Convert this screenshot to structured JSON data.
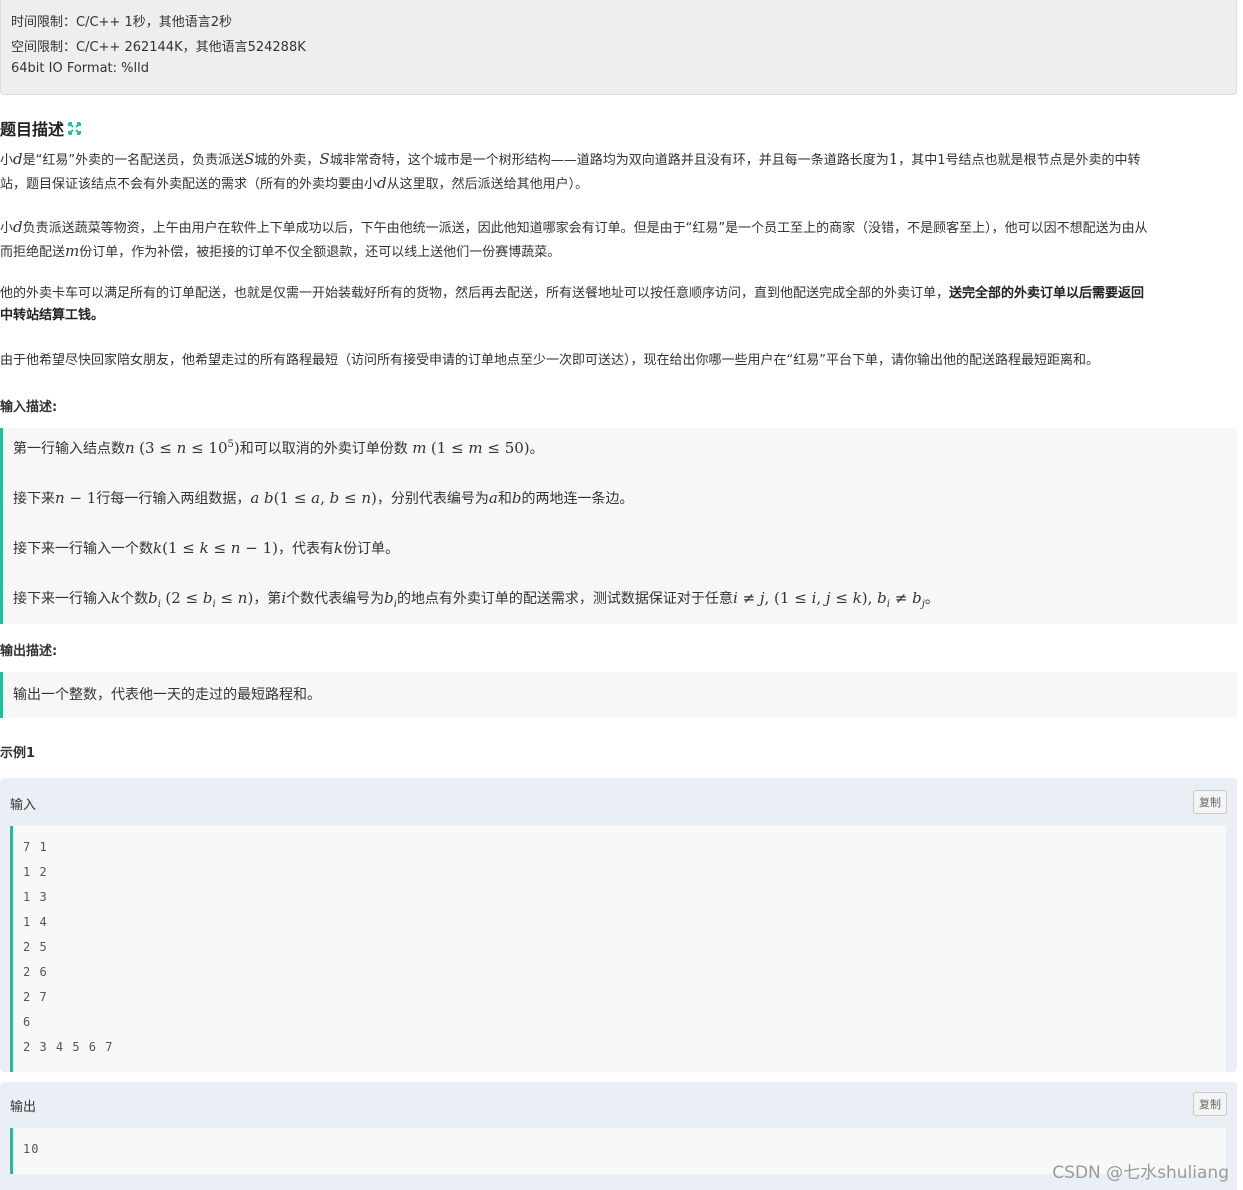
{
  "limits": {
    "time": "时间限制：C/C++ 1秒，其他语言2秒",
    "space": "空间限制：C/C++ 262144K，其他语言524288K",
    "io": "64bit IO Format: %lld"
  },
  "problem": {
    "title": "题目描述",
    "paragraphs": {
      "p1a": "小",
      "p1b": "是“红易”外卖的一名配送员，负责派送",
      "p1c": "城的外卖，",
      "p1d": "城非常奇特，这个城市是一个树形结构——道路均为双向道路并且没有环，并且每一条道路长度为",
      "p1e": "，其中1号结点也就是根节点是外卖的中转",
      "p1f": "站，题目保证该结点不会有外卖配送的需求（所有的外卖均要由小",
      "p1g": "从这里取，然后派送给其他用户）。",
      "p2a": "小",
      "p2b": "负责派送蔬菜等物资，上午由用户在软件上下单成功以后，下午由他统一派送，因此他知道哪家会有订单。但是由于“红易”是一个员工至上的商家（没错，不是顾客至上），他可以因不想配送为由从",
      "p2c": "而拒绝配送",
      "p2d": "份订单，作为补偿，被拒接的订单不仅全额退款，还可以线上送他们一份赛博蔬菜。",
      "p3a": "他的外卖卡车可以满足所有的订单配送，也就是仅需一开始装载好所有的货物，然后再去配送，所有送餐地址可以按任意顺序访问，直到他配送完成全部的外卖订单，",
      "p3b": "送完全部的外卖订单以后需要返回",
      "p3c": "中转站结算工钱。",
      "p4": "由于他希望尽快回家陪女朋友，他希望走过的所有路程最短（访问所有接受申请的订单地点至少一次即可送达），现在给出你哪一些用户在“红易”平台下单，请你输出他的配送路程最短距离和。"
    },
    "math": {
      "d": "d",
      "S": "S",
      "one": "1",
      "m": "m"
    }
  },
  "input": {
    "label": "输入描述:",
    "l1a": "第一行输入结点数",
    "l1b": "和可以取消的外卖订单份数 ",
    "l1c": "。",
    "l2a": "接下来",
    "l2b": "行每一行输入两组数据，",
    "l2c": "，分别代表编号为",
    "l2d": "和",
    "l2e": "的两地连一条边。",
    "l3a": "接下来一行输入一个数",
    "l3b": "，代表有",
    "l3c": "份订单。",
    "l4a": "接下来一行输入",
    "l4b": "个数",
    "l4c": "，第",
    "l4d": "个数代表编号为",
    "l4e": "的地点有外卖订单的配送需求，测试数据保证对于任意",
    "l4f": "。"
  },
  "output": {
    "label": "输出描述:",
    "text": "输出一个整数，代表他一天的走过的最短路程和。"
  },
  "example": {
    "label": "示例1",
    "input_label": "输入",
    "output_label": "输出",
    "copy_label": "复制",
    "input_lines": [
      "7 1",
      "1 2",
      "1 3",
      "1 4",
      "2 5",
      "2 6",
      "2 7",
      "6",
      "2 3 4 5 6 7"
    ],
    "output_lines": [
      "10"
    ]
  },
  "watermark": "CSDN @七水shuliang",
  "colors": {
    "accent": "#25bb9b",
    "panel": "#eeeeee",
    "example_bg": "#eaeef5"
  }
}
